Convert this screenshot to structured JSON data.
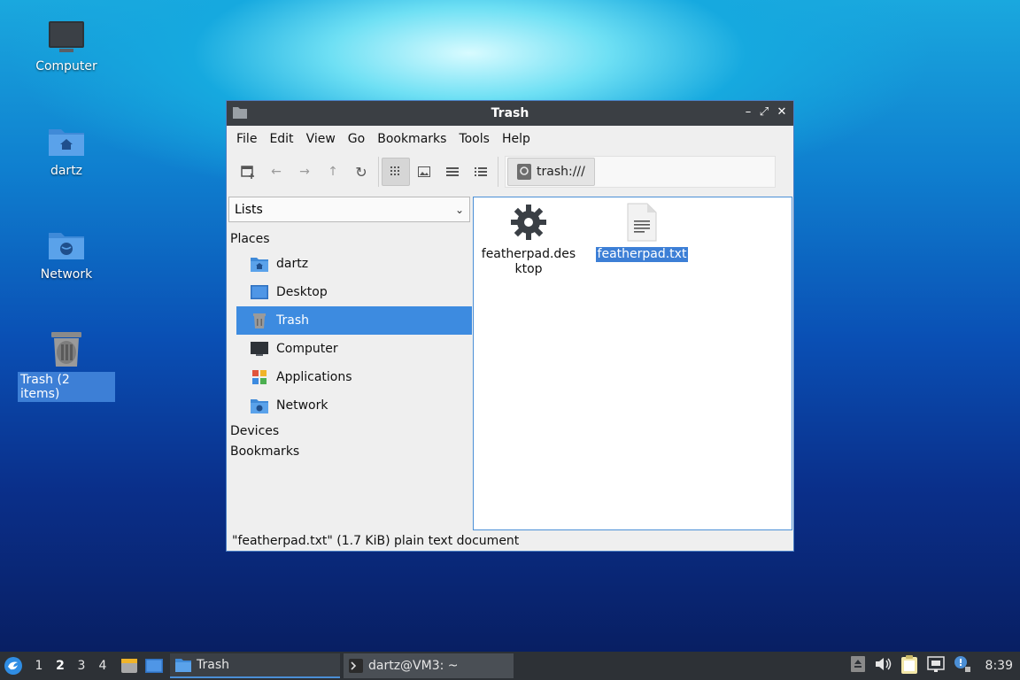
{
  "desktop": {
    "icons": [
      {
        "label": "Computer"
      },
      {
        "label": "dartz"
      },
      {
        "label": "Network"
      },
      {
        "label": "Trash (2 items)"
      }
    ]
  },
  "window": {
    "title": "Trash",
    "menu": [
      "File",
      "Edit",
      "View",
      "Go",
      "Bookmarks",
      "Tools",
      "Help"
    ],
    "path": "trash:///",
    "side_dropdown": "Lists",
    "sections": {
      "places": "Places",
      "devices": "Devices",
      "bookmarks": "Bookmarks"
    },
    "places": [
      {
        "label": "dartz"
      },
      {
        "label": "Desktop"
      },
      {
        "label": "Trash",
        "selected": true
      },
      {
        "label": "Computer"
      },
      {
        "label": "Applications"
      },
      {
        "label": "Network"
      }
    ],
    "files": [
      {
        "name": "featherpad.desktop",
        "icon": "gear-icon",
        "selected": false
      },
      {
        "name": "featherpad.txt",
        "icon": "text-file-icon",
        "selected": true
      }
    ],
    "status": "\"featherpad.txt\" (1.7 KiB) plain text document"
  },
  "taskbar": {
    "workspaces": [
      "1",
      "2",
      "3",
      "4"
    ],
    "tasks": [
      {
        "label": "Trash"
      },
      {
        "label": "dartz@VM3: ~"
      }
    ],
    "clock": "8:39"
  }
}
